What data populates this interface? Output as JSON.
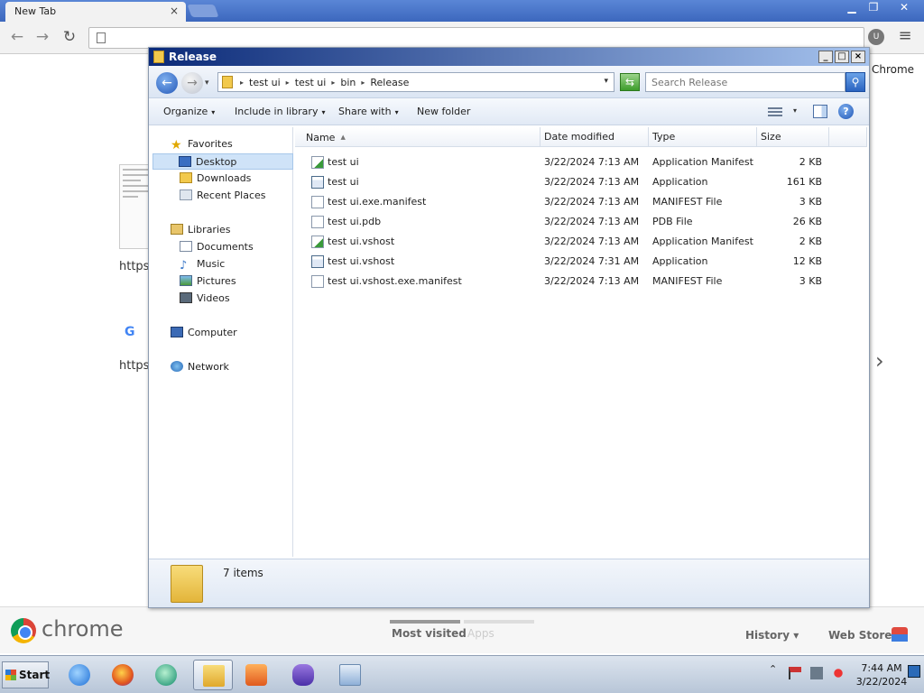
{
  "chrome": {
    "tab_title": "New Tab",
    "tab_close": "×",
    "win_min": "▁",
    "win_max": "❐",
    "win_close": "✕",
    "back_glyph": "←",
    "forward_glyph": "→",
    "reload_glyph": "↻",
    "ext_icon_label": "U",
    "menu_glyph": "≡",
    "right_label": "Chrome",
    "tile1_label": "https",
    "tile2_letter": "G",
    "tile2_label": "https",
    "next_glyph": "›",
    "logo_word": "chrome",
    "most_visited": "Most visited",
    "apps": "Apps",
    "history": "History",
    "history_dd": "▾",
    "web_store": "Web Store"
  },
  "explorer": {
    "title": "Release",
    "btn_min": "_",
    "btn_max": "□",
    "btn_close": "×",
    "back_glyph": "←",
    "forward_glyph": "→",
    "dd_glyph": "▾",
    "breadcrumbs": [
      "test ui",
      "test ui",
      "bin",
      "Release"
    ],
    "crumb_sep": "▸",
    "search_placeholder": "Search Release",
    "search_glyph": "⚲",
    "refresh_glyph": "⇆",
    "toolbar": {
      "organize": "Organize",
      "include_in_library": "Include in library",
      "share_with": "Share with",
      "new_folder": "New folder",
      "help": "?"
    },
    "nav": {
      "favorites": "Favorites",
      "desktop": "Desktop",
      "downloads": "Downloads",
      "recent_places": "Recent Places",
      "libraries": "Libraries",
      "documents": "Documents",
      "music": "Music",
      "pictures": "Pictures",
      "videos": "Videos",
      "computer": "Computer",
      "network": "Network",
      "star_glyph": "★",
      "note_glyph": "♪"
    },
    "columns": {
      "name": "Name",
      "date_modified": "Date modified",
      "type": "Type",
      "size": "Size",
      "sort_glyph": "▲"
    },
    "files": [
      {
        "name": "test ui",
        "date": "3/22/2024 7:13 AM",
        "type": "Application Manifest",
        "size": "2 KB",
        "kind": "manifest"
      },
      {
        "name": "test ui",
        "date": "3/22/2024 7:13 AM",
        "type": "Application",
        "size": "161 KB",
        "kind": "app"
      },
      {
        "name": "test ui.exe.manifest",
        "date": "3/22/2024 7:13 AM",
        "type": "MANIFEST File",
        "size": "3 KB",
        "kind": "file"
      },
      {
        "name": "test ui.pdb",
        "date": "3/22/2024 7:13 AM",
        "type": "PDB File",
        "size": "26 KB",
        "kind": "file"
      },
      {
        "name": "test ui.vshost",
        "date": "3/22/2024 7:13 AM",
        "type": "Application Manifest",
        "size": "2 KB",
        "kind": "manifest"
      },
      {
        "name": "test ui.vshost",
        "date": "3/22/2024 7:31 AM",
        "type": "Application",
        "size": "12 KB",
        "kind": "app"
      },
      {
        "name": "test ui.vshost.exe.manifest",
        "date": "3/22/2024 7:13 AM",
        "type": "MANIFEST File",
        "size": "3 KB",
        "kind": "file"
      }
    ],
    "item_count": "7 items"
  },
  "taskbar": {
    "start": "Start",
    "tray_up_glyph": "⌃",
    "clock_time": "7:44 AM",
    "clock_date": "3/22/2024",
    "apps": [
      "internet-explorer",
      "firefox",
      "app-green",
      "windows-explorer",
      "media-player",
      "visual-studio",
      "control-panel"
    ]
  }
}
